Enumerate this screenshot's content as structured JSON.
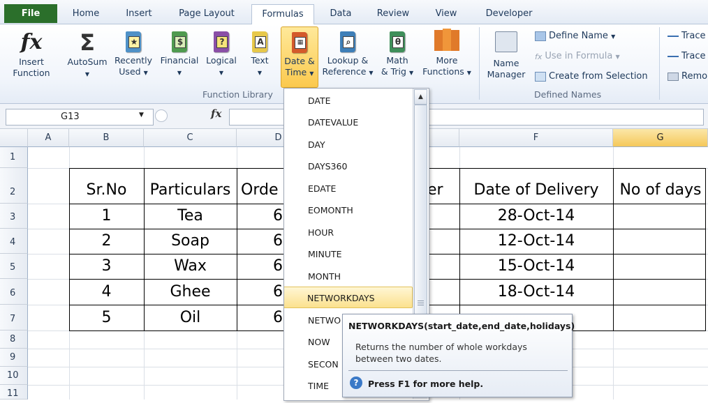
{
  "tabs": [
    "File",
    "Home",
    "Insert",
    "Page Layout",
    "Formulas",
    "Data",
    "Review",
    "View",
    "Developer"
  ],
  "ribbon": {
    "insert_function": [
      "Insert",
      "Function"
    ],
    "autosum": "AutoSum",
    "recently_used": [
      "Recently",
      "Used"
    ],
    "financial": "Financial",
    "logical": "Logical",
    "text": "Text",
    "date_time": [
      "Date &",
      "Time"
    ],
    "lookup": [
      "Lookup &",
      "Reference"
    ],
    "math": [
      "Math",
      "& Trig"
    ],
    "more": [
      "More",
      "Functions"
    ],
    "function_library": "Function Library",
    "name_manager": [
      "Name",
      "Manager"
    ],
    "define_name": "Define Name",
    "use_in_formula": "Use in Formula",
    "create_from_selection": "Create from Selection",
    "defined_names": "Defined Names",
    "trace1": "Trace",
    "trace2": "Trace",
    "remove": "Remo"
  },
  "formula_bar": {
    "name_box": "G13",
    "fx": "fx",
    "formula": ""
  },
  "columns": [
    "A",
    "B",
    "C",
    "D",
    "E",
    "F",
    "G"
  ],
  "rows": [
    "1",
    "2",
    "3",
    "4",
    "5",
    "6",
    "7",
    "8",
    "9",
    "10",
    "11"
  ],
  "table": {
    "headers": [
      "Sr.No",
      "Particulars",
      "Orde",
      "er",
      "Date of Delivery",
      "No of days"
    ],
    "rows": [
      [
        "1",
        "Tea",
        "6",
        "28-Oct-14"
      ],
      [
        "2",
        "Soap",
        "6",
        "12-Oct-14"
      ],
      [
        "3",
        "Wax",
        "6",
        "15-Oct-14"
      ],
      [
        "4",
        "Ghee",
        "6",
        "18-Oct-14"
      ],
      [
        "5",
        "Oil",
        "6",
        ""
      ]
    ]
  },
  "dropdown": [
    "DATE",
    "DATEVALUE",
    "DAY",
    "DAYS360",
    "EDATE",
    "EOMONTH",
    "HOUR",
    "MINUTE",
    "MONTH",
    "NETWORKDAYS",
    "NETWO",
    "NOW",
    "SECON",
    "TIME"
  ],
  "dropdown_selected": "NETWORKDAYS",
  "tooltip": {
    "signature": "NETWORKDAYS(start_date,end_date,holidays)",
    "description": "Returns the number of whole workdays between two dates.",
    "help": "Press F1 for more help."
  }
}
